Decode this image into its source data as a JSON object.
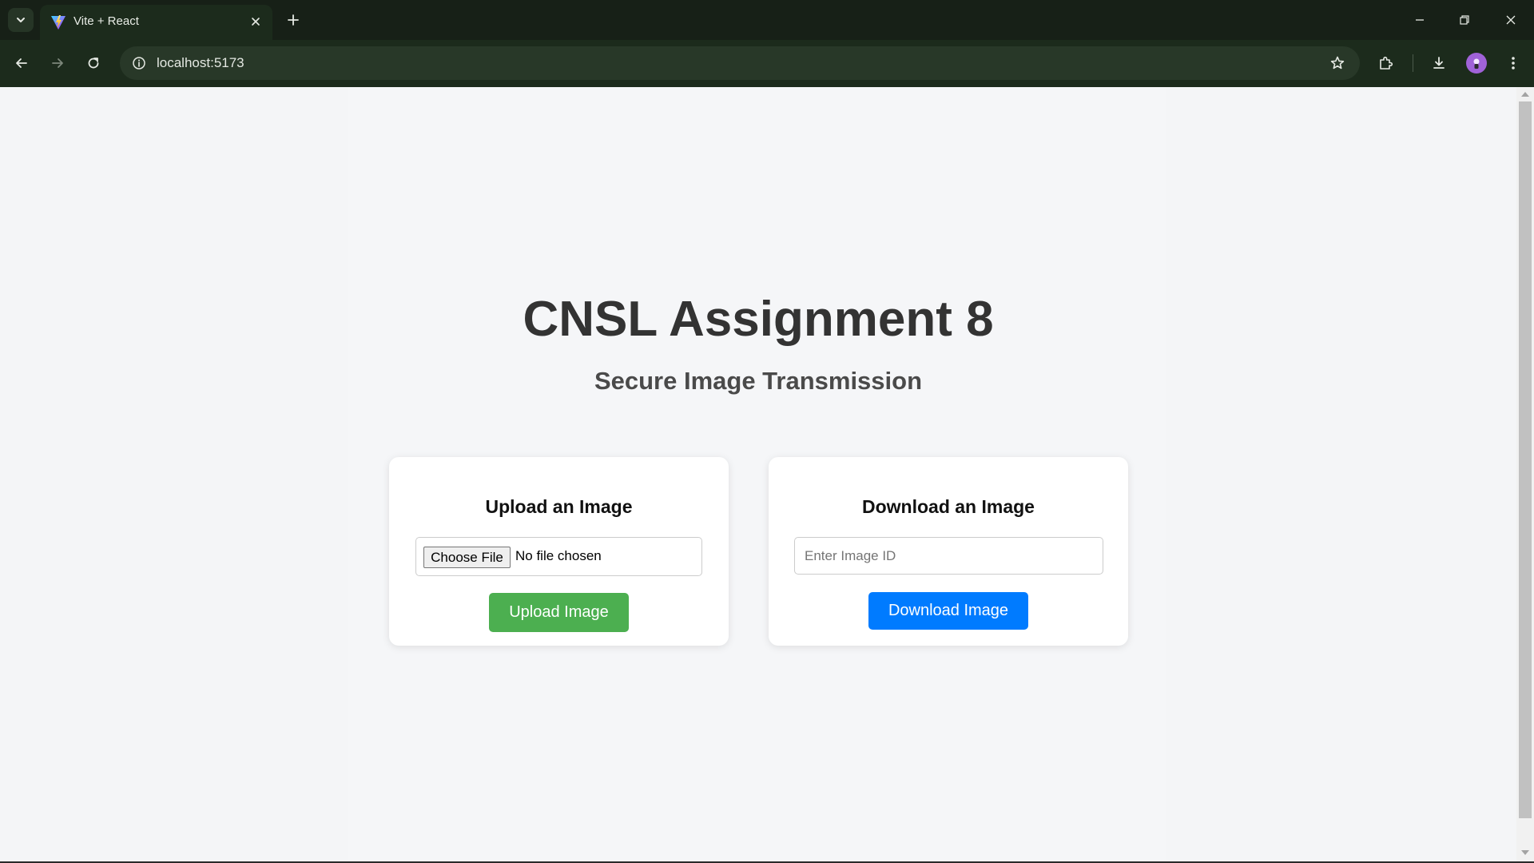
{
  "browser": {
    "tab": {
      "title": "Vite + React",
      "favicon": "vite-logo-icon"
    },
    "url": "localhost:5173",
    "colors": {
      "frame": "#172017",
      "toolbar": "#1c2b1c",
      "omnibox": "#283828",
      "avatar": "#a062d8"
    }
  },
  "page": {
    "title": "CNSL Assignment 8",
    "subtitle": "Secure Image Transmission",
    "upload_card": {
      "heading": "Upload an Image",
      "choose_file_label": "Choose File",
      "file_status": "No file chosen",
      "button_label": "Upload Image",
      "button_color": "#4caf50"
    },
    "download_card": {
      "heading": "Download an Image",
      "input_placeholder": "Enter Image ID",
      "input_value": "",
      "button_label": "Download Image",
      "button_color": "#007bff"
    }
  }
}
